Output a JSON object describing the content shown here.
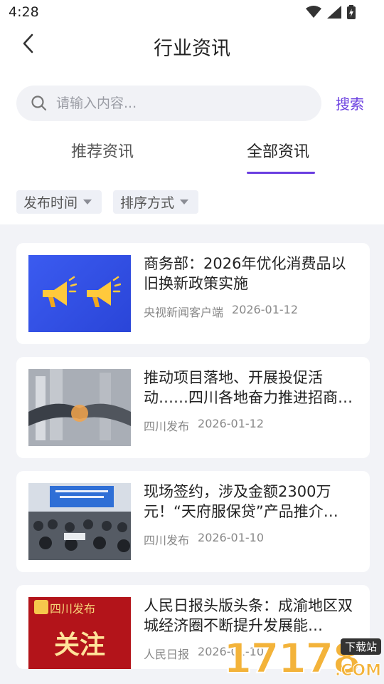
{
  "status": {
    "time": "4:28"
  },
  "header": {
    "title": "行业资讯"
  },
  "search": {
    "placeholder": "请输入内容...",
    "button_label": "搜索"
  },
  "tabs": [
    {
      "label": "推荐资讯",
      "active": false
    },
    {
      "label": "全部资讯",
      "active": true
    }
  ],
  "filters": [
    {
      "label": "发布时间"
    },
    {
      "label": "排序方式"
    }
  ],
  "articles": [
    {
      "title": "商务部：2026年优化消费品以旧换新政策实施",
      "source": "央视新闻客户端",
      "date": "2026-01-12",
      "thumb": "megaphone-banner"
    },
    {
      "title": "推动项目落地、开展投促活动……四川各地奋力推进招商…",
      "source": "四川发布",
      "date": "2026-01-12",
      "thumb": "handshake-photo"
    },
    {
      "title": "现场签约，涉及金额2300万元！“天府服保贷”产品推介…",
      "source": "四川发布",
      "date": "2026-01-10",
      "thumb": "conference-photo"
    },
    {
      "title": "人民日报头版头条：成渝地区双城经济圈不断提升发展能…",
      "source": "人民日报",
      "date": "2026-01-10",
      "thumb": "red-banner",
      "thumb_text": {
        "brand": "四川发布",
        "main": "关注"
      }
    }
  ],
  "watermark": {
    "number": "17178",
    "tag": "下载站",
    "suffix": ".COM"
  },
  "colors": {
    "accent": "#6a3ee0",
    "background": "#f2f3f7",
    "card": "#ffffff"
  }
}
